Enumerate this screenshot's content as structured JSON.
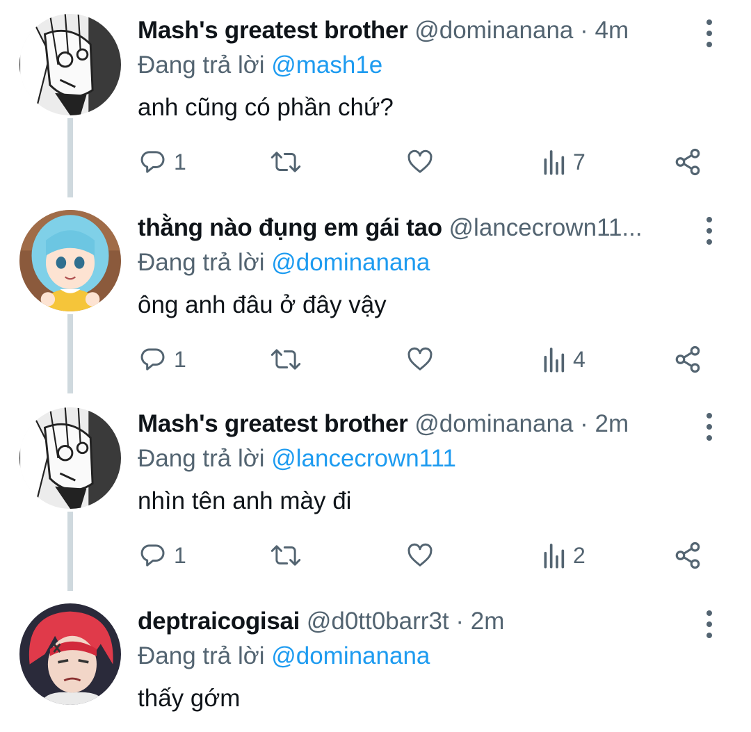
{
  "labels": {
    "replying_prefix": "Đang trả lời",
    "separator": "·"
  },
  "colors": {
    "text": "#0f1419",
    "secondary": "#536471",
    "link": "#1d9bf0",
    "thread_line": "#cfd9de"
  },
  "tweets": [
    {
      "name": "Mash's greatest brother",
      "handle": "@dominanana",
      "time": "4m",
      "replying_to": "@mash1e",
      "text": "anh cũng có phần chứ?",
      "replies": "1",
      "views": "7",
      "avatar_icon": "manga-avatar-icon"
    },
    {
      "name": "thằng nào đụng em gái tao",
      "handle": "@lancecrown11...",
      "time": "",
      "replying_to": "@dominanana",
      "text": "ông anh đâu ở đây vậy",
      "replies": "1",
      "views": "4",
      "avatar_icon": "anime-girl-avatar-icon"
    },
    {
      "name": "Mash's greatest brother",
      "handle": "@dominanana",
      "time": "2m",
      "replying_to": "@lancecrown111",
      "text": "nhìn tên anh mày đi",
      "replies": "1",
      "views": "2",
      "avatar_icon": "manga-avatar-icon"
    },
    {
      "name": "deptraicogisai",
      "handle": "@d0tt0barr3t",
      "time": "2m",
      "replying_to": "@dominanana",
      "text": "thấy gớm",
      "avatar_icon": "red-hair-avatar-icon"
    }
  ]
}
